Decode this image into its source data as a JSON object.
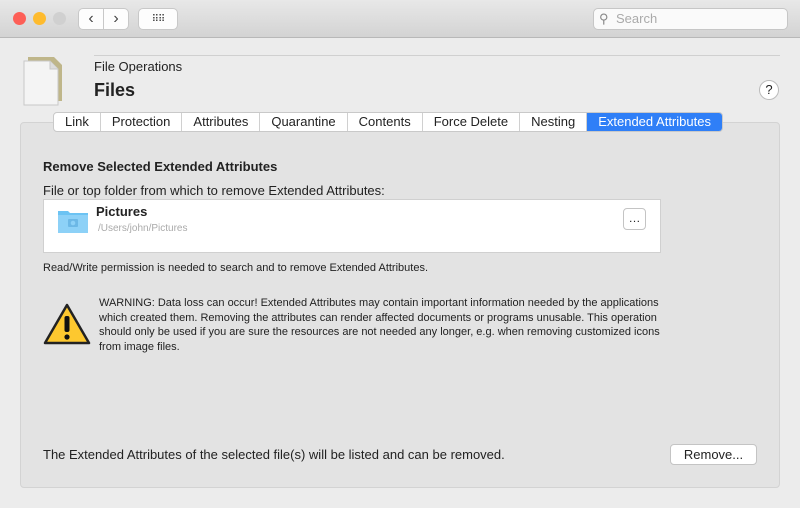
{
  "window": {
    "search_placeholder": "Search",
    "colors": {
      "close": "#fd5f57",
      "minimize": "#febb2e",
      "accent": "#2f7ff7"
    }
  },
  "header": {
    "subtitle": "File Operations",
    "title": "Files",
    "help": "?"
  },
  "tabs": [
    {
      "label": "Link"
    },
    {
      "label": "Protection"
    },
    {
      "label": "Attributes"
    },
    {
      "label": "Quarantine"
    },
    {
      "label": "Contents"
    },
    {
      "label": "Force Delete"
    },
    {
      "label": "Nesting"
    },
    {
      "label": "Extended Attributes",
      "selected": true
    }
  ],
  "main": {
    "heading": "Remove Selected Extended Attributes",
    "file_label": "File or top folder from which to remove Extended Attributes:",
    "file": {
      "name": "Pictures",
      "path": "/Users/john/Pictures",
      "browse": "…"
    },
    "permission_note": "Read/Write permission is needed to search and to remove Extended Attributes.",
    "warning": "WARNING: Data loss can occur! Extended Attributes may contain important information needed by the applications which created them. Removing the attributes can render affected documents or programs unusable. This operation should only be used if you are sure the resources are not needed any longer, e.g. when removing customized icons from image files.",
    "footer_text": "The Extended Attributes of the selected file(s) will be listed and can be removed.",
    "remove_button": "Remove..."
  }
}
